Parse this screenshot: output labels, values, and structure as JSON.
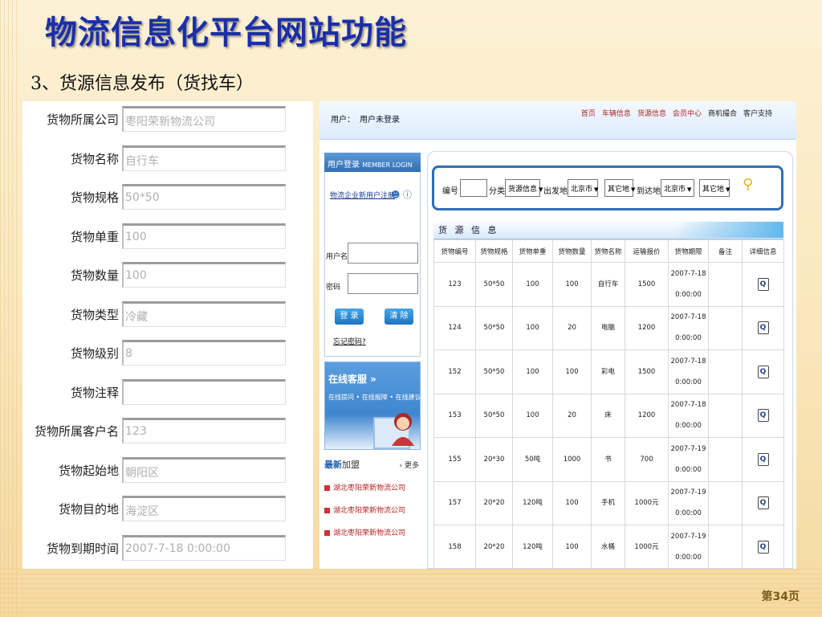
{
  "slide": {
    "title": "物流信息化平台网站功能",
    "subtitle": "3、货源信息发布（货找车）",
    "page_num": "第34页"
  },
  "form": {
    "rows": [
      {
        "label": "货物所属公司",
        "value": "枣阳荣新物流公司"
      },
      {
        "label": "货物名称",
        "value": "自行车"
      },
      {
        "label": "货物规格",
        "value": "50*50"
      },
      {
        "label": "货物单重",
        "value": "100"
      },
      {
        "label": "货物数量",
        "value": "100"
      },
      {
        "label": "货物类型",
        "value": "冷藏"
      },
      {
        "label": "货物级别",
        "value": "8"
      },
      {
        "label": "货物注释",
        "value": ""
      },
      {
        "label": "货物所属客户名",
        "value": "123"
      },
      {
        "label": "货物起始地",
        "value": "朝阳区"
      },
      {
        "label": "货物目的地",
        "value": "海淀区"
      },
      {
        "label": "货物到期时间",
        "value": "2007-7-18 0:00:00"
      }
    ]
  },
  "web": {
    "user_label": "用户：",
    "user_status": "用户未登录",
    "nav": [
      "首页",
      "车辆信息",
      "货源信息",
      "会员中心",
      "商机撮合",
      "客户支持"
    ],
    "login": {
      "title": "用户登录",
      "title_en": "MEMBER LOGIN",
      "register_link": "物流企业新用户注册",
      "username_label": "用户名",
      "password_label": "密码",
      "login_btn": "登 录",
      "clear_btn": "清 除",
      "forgot": "忘记密码?"
    },
    "online": {
      "title": "在线客服 »",
      "sub": "在线提问 • 在线报障 • 在线建议"
    },
    "newjoin": {
      "title_a": "最新",
      "title_b": "加盟",
      "more": "› 更多",
      "items": [
        "湖北枣阳荣新物流公司",
        "湖北枣阳荣新物流公司",
        "湖北枣阳荣新物流公司"
      ]
    },
    "search": {
      "code_label": "编号",
      "category_label": "分类",
      "category_value": "货源信息",
      "from_label": "出发地:",
      "from_city": "北京市",
      "from_district": "其它地",
      "to_label": "到达地:",
      "to_city": "北京市",
      "to_district": "其它地"
    },
    "goods": {
      "title": "货 源 信 息",
      "columns": [
        "货物编号",
        "货物规格",
        "货物单重",
        "货物数量",
        "货物名称",
        "运输报价",
        "货物期限",
        "备注",
        "详细信息"
      ],
      "rows": [
        {
          "id": "123",
          "spec": "50*50",
          "weight": "100",
          "qty": "100",
          "name": "自行车",
          "price": "1500",
          "date": "2007-7-18",
          "time": "0:00:00",
          "note": "",
          "detail": "Q"
        },
        {
          "id": "124",
          "spec": "50*50",
          "weight": "100",
          "qty": "20",
          "name": "电脑",
          "price": "1200",
          "date": "2007-7-18",
          "time": "0:00:00",
          "note": "",
          "detail": "Q"
        },
        {
          "id": "152",
          "spec": "50*50",
          "weight": "100",
          "qty": "100",
          "name": "彩电",
          "price": "1500",
          "date": "2007-7-18",
          "time": "0:00:00",
          "note": "",
          "detail": "Q"
        },
        {
          "id": "153",
          "spec": "50*50",
          "weight": "100",
          "qty": "20",
          "name": "床",
          "price": "1200",
          "date": "2007-7-18",
          "time": "0:00:00",
          "note": "",
          "detail": "Q"
        },
        {
          "id": "155",
          "spec": "20*30",
          "weight": "50吨",
          "qty": "1000",
          "name": "书",
          "price": "700",
          "date": "2007-7-19",
          "time": "0:00:00",
          "note": "",
          "detail": "Q"
        },
        {
          "id": "157",
          "spec": "20*20",
          "weight": "120吨",
          "qty": "100",
          "name": "手机",
          "price": "1000元",
          "date": "2007-7-19",
          "time": "0:00:00",
          "note": "",
          "detail": "Q"
        },
        {
          "id": "158",
          "spec": "20*20",
          "weight": "120吨",
          "qty": "100",
          "name": "水桶",
          "price": "1000元",
          "date": "2007-7-19",
          "time": "0:00:00",
          "note": "",
          "detail": "Q"
        }
      ]
    }
  },
  "colors": {
    "title_blue": "#1a2fa8",
    "nav_red": "#b32222",
    "accent_blue": "#2f6fb4"
  },
  "icons": {
    "help": "help-icon",
    "user": "user-icon",
    "search_key": "search-key-icon",
    "detail": "magnifier-icon"
  }
}
